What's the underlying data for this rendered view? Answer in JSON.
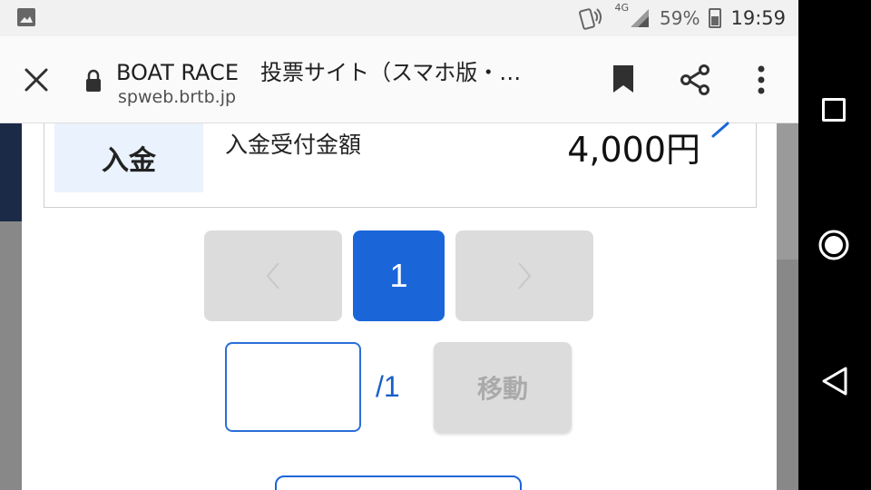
{
  "status_bar": {
    "network": "4G",
    "battery": "59%",
    "time": "19:59",
    "icons": [
      "image-notification-icon",
      "nfc-signal-icon",
      "cell-signal-icon",
      "battery-icon"
    ]
  },
  "browser": {
    "title": "BOAT RACE　投票サイト（スマホ版・…",
    "url": "spweb.brtb.jp",
    "icons": [
      "close-icon",
      "lock-icon",
      "bookmark-icon",
      "share-icon",
      "menu-icon"
    ]
  },
  "deposit": {
    "label": "入金",
    "description": "入金受付金額",
    "amount": "4,000円"
  },
  "pagination": {
    "current_page": "1",
    "total_pages": "/1",
    "page_input_value": "",
    "move_label": "移動"
  },
  "colors": {
    "accent": "#1a66d9",
    "disabled": "#dcdcdc",
    "label_bg": "#eaf2fd"
  },
  "navigation_bar": {
    "icons": [
      "recents-icon",
      "home-icon",
      "back-icon"
    ]
  }
}
